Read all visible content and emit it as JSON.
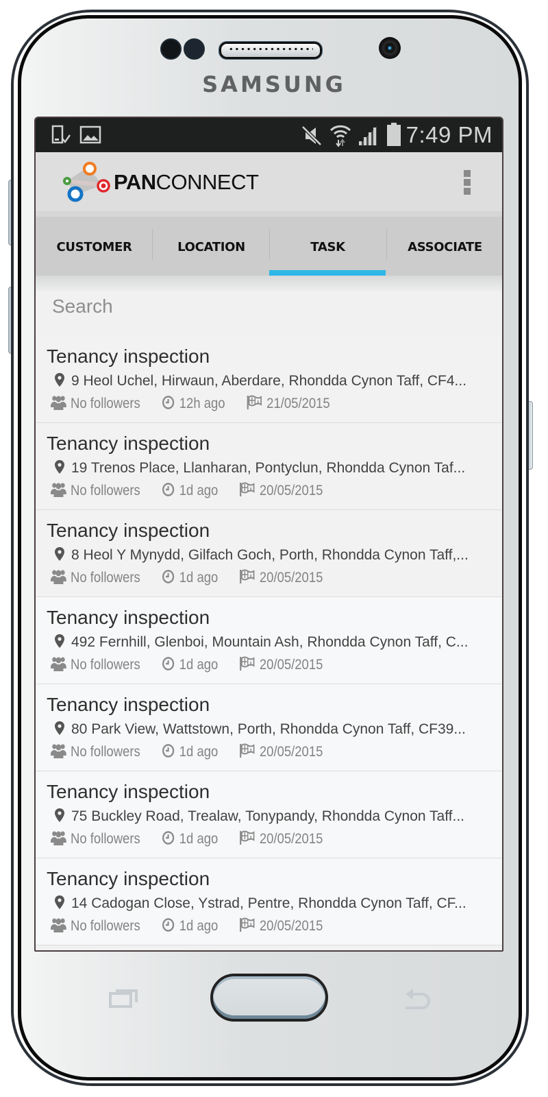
{
  "device": {
    "brand": "SAMSUNG"
  },
  "status_bar": {
    "left_icons": [
      "download-done-icon",
      "image-notification-icon"
    ],
    "right_icons": [
      "mute-icon",
      "wifi-icon",
      "signal-icon",
      "battery-icon"
    ],
    "time": "7:49 PM"
  },
  "app_bar": {
    "logo_bold": "PAN",
    "logo_light": "CONNECT",
    "logo_colors": {
      "orange": "#f07c22",
      "green": "#4d9a43",
      "red": "#e0262b",
      "blue": "#1574c4"
    },
    "overflow_icon": "more-vert-icon"
  },
  "tabs": {
    "items": [
      {
        "label": "CUSTOMER",
        "active": false
      },
      {
        "label": "LOCATION",
        "active": false
      },
      {
        "label": "TASK",
        "active": true
      },
      {
        "label": "ASSOCIATE",
        "active": false
      }
    ],
    "accent": "#2db6e6"
  },
  "search": {
    "placeholder": "Search",
    "value": ""
  },
  "tasks": [
    {
      "title": "Tenancy inspection",
      "address": "9 Heol Uchel, Hirwaun, Aberdare, Rhondda Cynon Taff, CF4...",
      "followers": "No followers",
      "age": "12h ago",
      "date": "21/05/2015"
    },
    {
      "title": "Tenancy inspection",
      "address": "19 Trenos Place, Llanharan, Pontyclun, Rhondda Cynon Taf...",
      "followers": "No followers",
      "age": "1d ago",
      "date": "20/05/2015"
    },
    {
      "title": "Tenancy inspection",
      "address": "8 Heol Y Mynydd, Gilfach Goch, Porth, Rhondda Cynon Taff,...",
      "followers": "No followers",
      "age": "1d ago",
      "date": "20/05/2015"
    },
    {
      "title": "Tenancy inspection",
      "address": "492 Fernhill, Glenboi, Mountain Ash, Rhondda Cynon Taff, C...",
      "followers": "No followers",
      "age": "1d ago",
      "date": "20/05/2015"
    },
    {
      "title": "Tenancy inspection",
      "address": "80 Park View, Wattstown, Porth, Rhondda Cynon Taff, CF39...",
      "followers": "No followers",
      "age": "1d ago",
      "date": "20/05/2015"
    },
    {
      "title": "Tenancy inspection",
      "address": "75 Buckley Road, Trealaw, Tonypandy, Rhondda Cynon Taff...",
      "followers": "No followers",
      "age": "1d ago",
      "date": "20/05/2015"
    },
    {
      "title": "Tenancy inspection",
      "address": "14 Cadogan Close, Ystrad, Pentre, Rhondda Cynon Taff, CF...",
      "followers": "No followers",
      "age": "1d ago",
      "date": "20/05/2015"
    }
  ],
  "nav_buttons": [
    "recent-apps",
    "home",
    "back"
  ]
}
